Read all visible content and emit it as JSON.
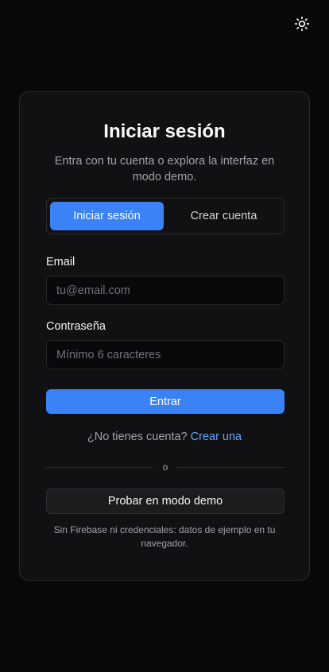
{
  "theme_toggle": {
    "icon": "sun-icon"
  },
  "auth": {
    "title": "Iniciar sesión",
    "subtitle": "Entra con tu cuenta o explora la interfaz en modo demo.",
    "tabs": [
      {
        "label": "Iniciar sesión",
        "active": true
      },
      {
        "label": "Crear cuenta",
        "active": false
      }
    ],
    "email": {
      "label": "Email",
      "value": "",
      "placeholder": "tu@email.com"
    },
    "password": {
      "label": "Contraseña",
      "value": "",
      "placeholder": "Mínimo 6 caracteres"
    },
    "submit_label": "Entrar",
    "signup_prompt": "¿No tienes cuenta?",
    "signup_link": "Crear una",
    "divider_text": "o",
    "demo_button_label": "Probar en modo demo",
    "demo_note": "Sin Firebase ni credenciales: datos de ejemplo en tu navegador."
  },
  "colors": {
    "background": "#09090b",
    "card": "#111113",
    "accent": "#3b82f6",
    "link": "#60a5fa"
  }
}
